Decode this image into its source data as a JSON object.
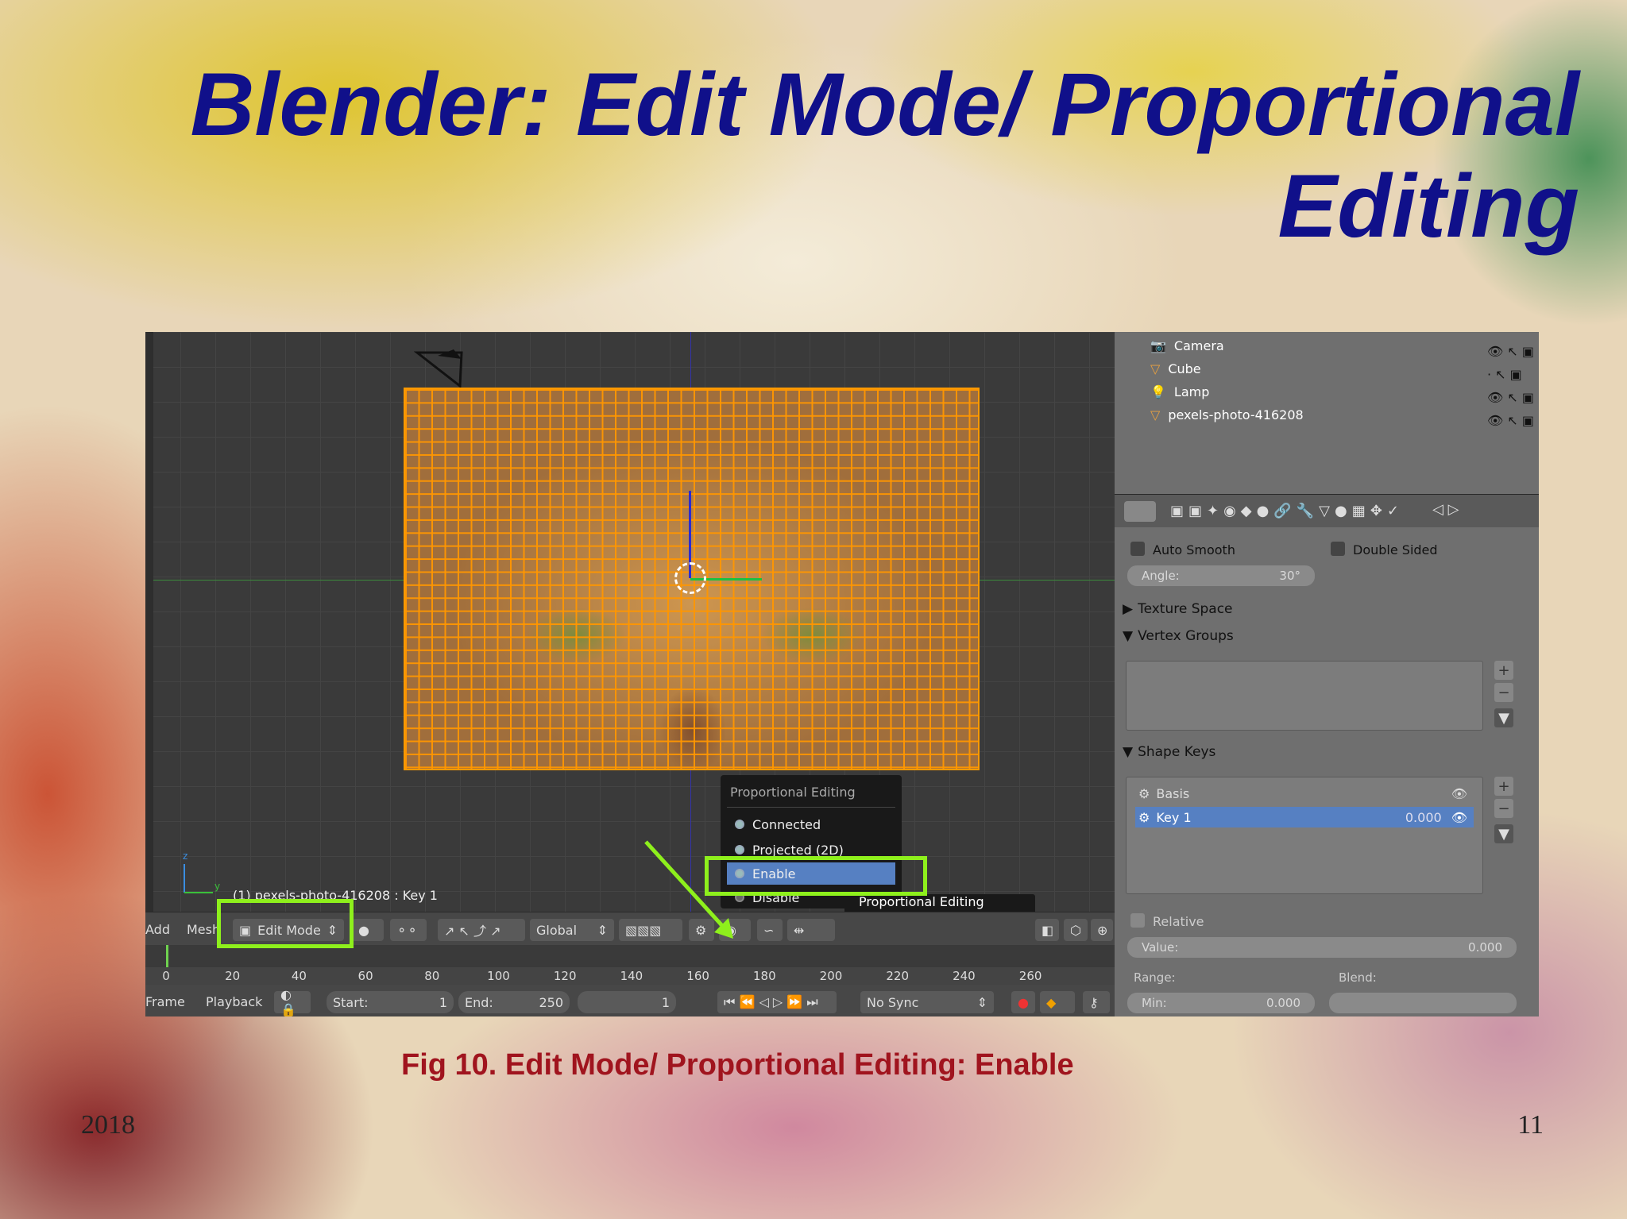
{
  "slide": {
    "title": "Blender: Edit Mode/ Proportional Editing",
    "caption": "Fig 10. Edit Mode/ Proportional Editing: Enable",
    "year": "2018",
    "page_number": "11"
  },
  "viewport": {
    "object_label": "(1) pexels-photo-416208 : Key 1"
  },
  "popup": {
    "title": "Proportional Editing",
    "items": [
      {
        "label": "Connected"
      },
      {
        "label": "Projected (2D)"
      },
      {
        "label": "Enable"
      },
      {
        "label": "Disable"
      }
    ],
    "active_item": "Enable",
    "tooltip": "Proportional Editing enabled"
  },
  "toolbar": {
    "add_label": "Add",
    "mesh_label": "Mesh",
    "mode_label": "Edit Mode",
    "orientation_label": "Global"
  },
  "timeline": {
    "ticks": [
      "0",
      "20",
      "40",
      "60",
      "80",
      "100",
      "120",
      "140",
      "160",
      "180",
      "200",
      "220",
      "240",
      "260"
    ],
    "frame_label": "Frame",
    "playback_label": "Playback",
    "start_label": "Start:",
    "start_value": "1",
    "end_label": "End:",
    "end_value": "250",
    "current_frame": "1",
    "sync_label": "No Sync"
  },
  "outliner": {
    "items": [
      {
        "label": "Camera",
        "icon": "camera-icon"
      },
      {
        "label": "Cube",
        "icon": "mesh-icon"
      },
      {
        "label": "Lamp",
        "icon": "lamp-icon"
      },
      {
        "label": "pexels-photo-416208",
        "icon": "mesh-icon"
      }
    ]
  },
  "properties": {
    "auto_smooth_label": "Auto Smooth",
    "double_sided_label": "Double Sided",
    "angle_label": "Angle:",
    "angle_value": "30°",
    "texture_space_label": "Texture Space",
    "vertex_groups_label": "Vertex Groups",
    "shape_keys_label": "Shape Keys",
    "shape_keys": [
      {
        "label": "Basis",
        "value": ""
      },
      {
        "label": "Key 1",
        "value": "0.000"
      }
    ],
    "relative_label": "Relative",
    "value_label": "Value:",
    "value_value": "0.000",
    "range_label": "Range:",
    "blend_label": "Blend:",
    "min_label": "Min:",
    "min_value": "0.000"
  },
  "colors": {
    "title": "#10108a",
    "caption": "#a0141e",
    "highlight": "#8ef01c",
    "selection": "#5680c2",
    "mesh_wire": "#ff9a00"
  }
}
